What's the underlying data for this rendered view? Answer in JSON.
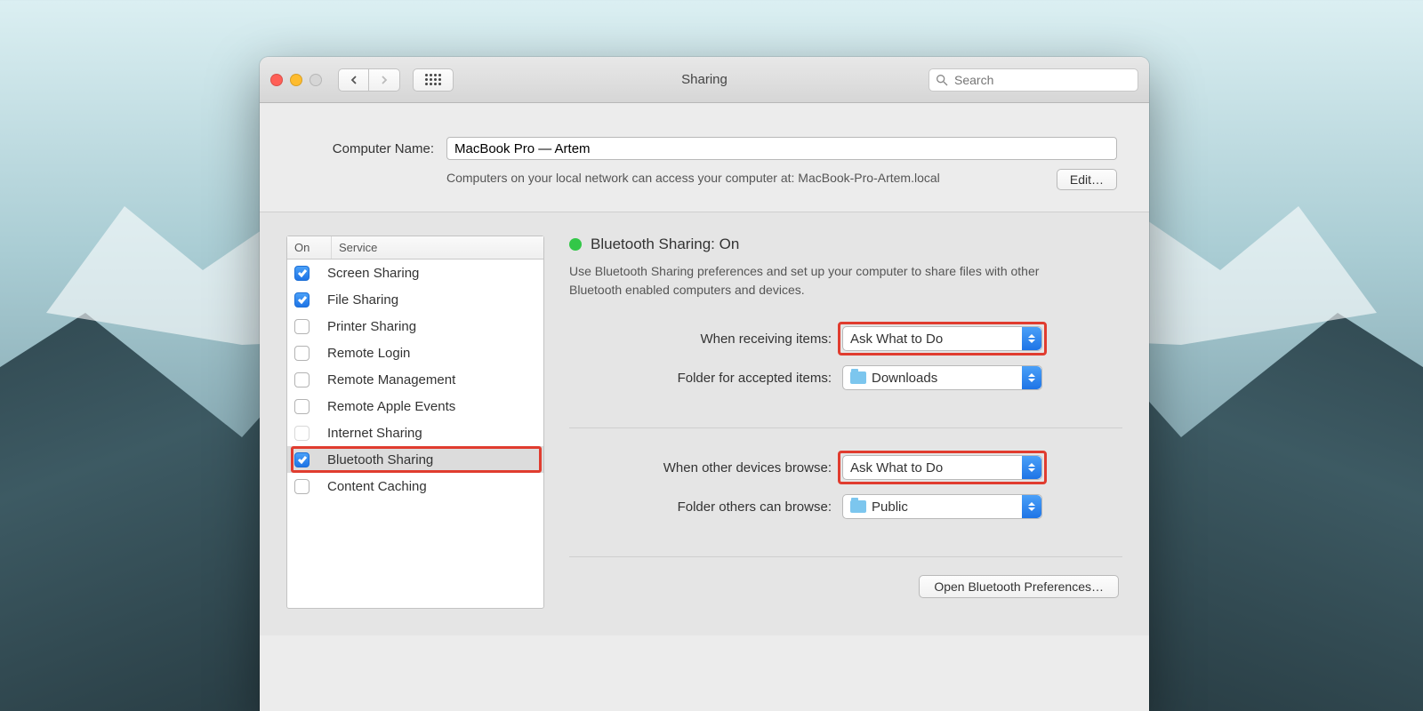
{
  "window": {
    "title": "Sharing",
    "search_placeholder": "Search"
  },
  "computer_name": {
    "label": "Computer Name:",
    "value": "MacBook Pro — Artem",
    "description": "Computers on your local network can access your computer at: MacBook-Pro-Artem.local",
    "edit_label": "Edit…"
  },
  "service_header": {
    "on": "On",
    "service": "Service"
  },
  "services": [
    {
      "label": "Screen Sharing",
      "checked": true,
      "selected": false,
      "highlight": false,
      "disabled": false
    },
    {
      "label": "File Sharing",
      "checked": true,
      "selected": false,
      "highlight": false,
      "disabled": false
    },
    {
      "label": "Printer Sharing",
      "checked": false,
      "selected": false,
      "highlight": false,
      "disabled": false
    },
    {
      "label": "Remote Login",
      "checked": false,
      "selected": false,
      "highlight": false,
      "disabled": false
    },
    {
      "label": "Remote Management",
      "checked": false,
      "selected": false,
      "highlight": false,
      "disabled": false
    },
    {
      "label": "Remote Apple Events",
      "checked": false,
      "selected": false,
      "highlight": false,
      "disabled": false
    },
    {
      "label": "Internet Sharing",
      "checked": false,
      "selected": false,
      "highlight": false,
      "disabled": true
    },
    {
      "label": "Bluetooth Sharing",
      "checked": true,
      "selected": true,
      "highlight": true,
      "disabled": false
    },
    {
      "label": "Content Caching",
      "checked": false,
      "selected": false,
      "highlight": false,
      "disabled": false
    }
  ],
  "detail": {
    "status_title": "Bluetooth Sharing: On",
    "description": "Use Bluetooth Sharing preferences and set up your computer to share files with other Bluetooth enabled computers and devices.",
    "group1": {
      "receive_label": "When receiving items:",
      "receive_value": "Ask What to Do",
      "folder_label": "Folder for accepted items:",
      "folder_value": "Downloads"
    },
    "group2": {
      "browse_label": "When other devices browse:",
      "browse_value": "Ask What to Do",
      "folder_label": "Folder others can browse:",
      "folder_value": "Public"
    },
    "open_bt_label": "Open Bluetooth Preferences…"
  },
  "colors": {
    "accent": "#1e74e6",
    "highlight": "#e03c2f",
    "status_on": "#33c748"
  }
}
